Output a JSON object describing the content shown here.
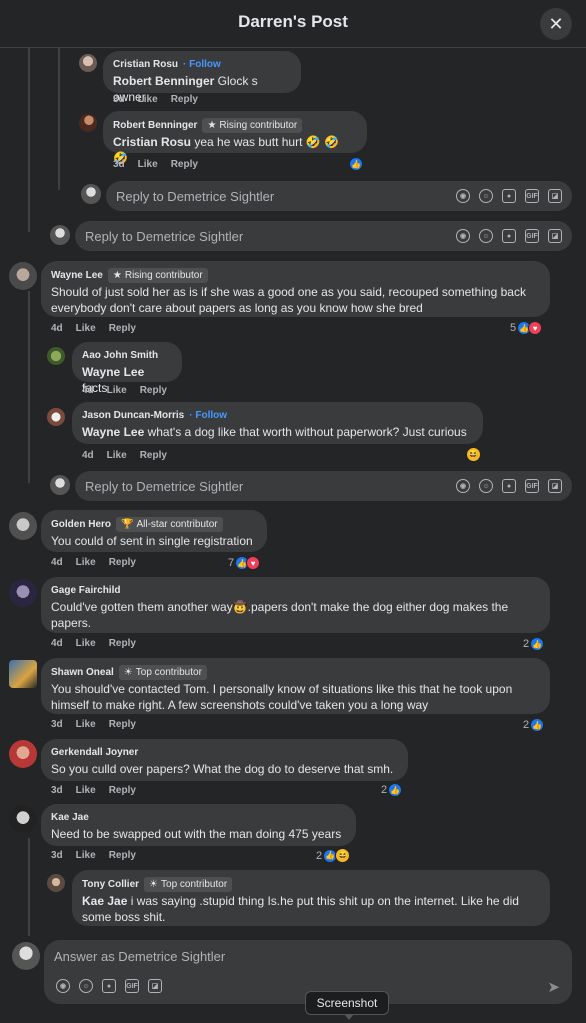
{
  "header": {
    "title": "Darren's Post",
    "close": "✕"
  },
  "comments": {
    "c1": {
      "author": "Cristian Rosu",
      "follow": "· Follow",
      "mention": "Robert Benninger",
      "text": " Glock s owner",
      "time": "3d",
      "like": "Like",
      "reply": "Reply"
    },
    "c2": {
      "author": "Robert Benninger",
      "badge": "Rising contributor",
      "mention": "Cristian Rosu",
      "text": " yea he was butt hurt 🤣 🤣 🤣",
      "time": "3d",
      "like": "Like",
      "reply": "Reply"
    },
    "c3": {
      "author": "Wayne Lee",
      "badge": "Rising contributor",
      "text": "Should of just sold her as is if she was a good one as you said, recouped something back everybody don't care about papers as long as you know how she bred",
      "time": "4d",
      "like": "Like",
      "reply": "Reply",
      "reactions": "5"
    },
    "c4": {
      "author": "Aao John Smith",
      "mention": "Wayne Lee",
      "text": " facts",
      "time": "4d",
      "like": "Like",
      "reply": "Reply"
    },
    "c5": {
      "author": "Jason Duncan-Morris",
      "follow": "· Follow",
      "mention": "Wayne Lee",
      "text": " what's a dog like that worth without paperwork? Just curious",
      "time": "4d",
      "like": "Like",
      "reply": "Reply"
    },
    "c6": {
      "author": "Golden Hero",
      "badge": "All-star contributor",
      "text": "You could of sent in single registration",
      "time": "4d",
      "like": "Like",
      "reply": "Reply",
      "reactions": "7"
    },
    "c7": {
      "author": "Gage Fairchild",
      "text": "Could've gotten them another way🤠.papers don't make the dog either dog makes the papers.",
      "time": "4d",
      "like": "Like",
      "reply": "Reply",
      "reactions": "2"
    },
    "c8": {
      "author": "Shawn Oneal",
      "badge": "Top contributor",
      "text": "You should've contacted Tom. I personally know of situations like this that he took upon himself to make right. A few screenshots could've taken you a long way",
      "time": "3d",
      "like": "Like",
      "reply": "Reply",
      "reactions": "2"
    },
    "c9": {
      "author": "Gerkendall Joyner",
      "text": "So you culld over papers? What the dog do to deserve that smh.",
      "time": "3d",
      "like": "Like",
      "reply": "Reply",
      "reactions": "2"
    },
    "c10": {
      "author": "Kae Jae",
      "text": "Need to be swapped out with the man doing 475 years",
      "time": "3d",
      "like": "Like",
      "reply": "Reply",
      "reactions": "2"
    },
    "c11": {
      "author": "Tony Collier",
      "badge": "Top contributor",
      "mention": "Kae Jae",
      "text": " i was saying .stupid thing Is.he put this shit up on the internet. Like he did some boss shit."
    }
  },
  "reply_boxes": {
    "r1": "Reply to Demetrice Sightler",
    "r2": "Reply to Demetrice Sightler",
    "r3": "Reply to Demetrice Sightler"
  },
  "composer": {
    "placeholder": "Answer as Demetrice Sightler"
  },
  "tooltip": "Screenshot",
  "colors": {
    "background": "#242526",
    "bubble": "#3a3b3c",
    "link": "#4599ff",
    "like_blue": "#1877f2",
    "heart_red": "#f33e58"
  }
}
